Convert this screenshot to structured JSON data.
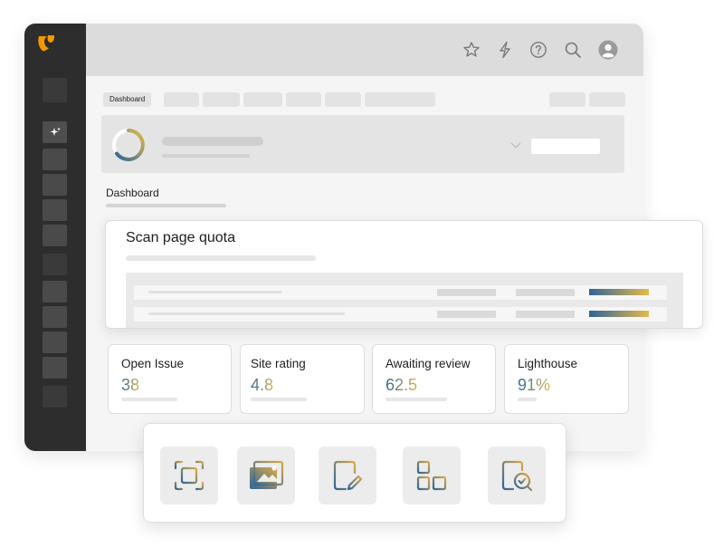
{
  "breadcrumb": {
    "first_label": "Dashboard"
  },
  "page": {
    "title": "Dashboard"
  },
  "scan_card": {
    "title": "Scan page quota"
  },
  "stats": [
    {
      "label": "Open Issue",
      "value": "38",
      "progress": 0.45
    },
    {
      "label": "Site rating",
      "value": "4.8",
      "progress": 0.45
    },
    {
      "label": "Awaiting review",
      "value": "62.5",
      "progress": 0.6
    },
    {
      "label": "Lighthouse",
      "value": "91%",
      "progress": 0.15
    }
  ],
  "topbar": {
    "icons": [
      "star-icon",
      "lightning-icon",
      "help-icon",
      "search-icon",
      "user-icon"
    ]
  },
  "sidebar": {
    "logo": "typo3-logo",
    "active_item": "sparkle-icon"
  },
  "tools": [
    "scan-icon",
    "image-icon",
    "edit-document-icon",
    "add-widget-icon",
    "review-document-icon"
  ],
  "colors": {
    "sidebar": "#2d2d2d",
    "logo_orange": "#f49700",
    "gradient_start": "#2f6596",
    "gradient_end": "#e5ba4b"
  }
}
